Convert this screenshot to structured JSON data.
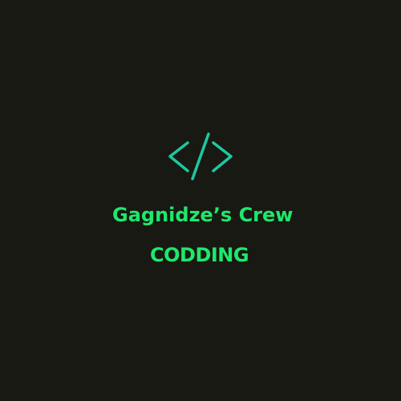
{
  "logo": {
    "icon_name": "code-brackets-icon",
    "accent_color": "#1ec7a2"
  },
  "brand": {
    "name": "Gagnidze’s Crew",
    "tagline": "CODDING",
    "text_color": "#1ee86c"
  },
  "background_color": "#181912"
}
